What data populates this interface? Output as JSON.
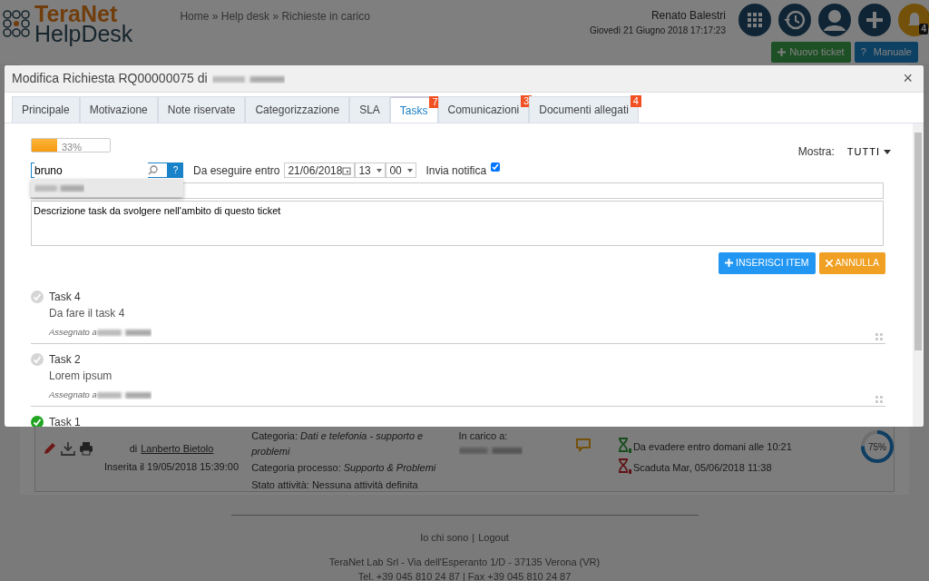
{
  "header": {
    "logo_top": "TeraNet",
    "logo_bottom": "HelpDesk",
    "breadcrumb": "Home » Help desk » Richieste in carico",
    "user_name": "Renato Balestri",
    "datetime": "Giovedì 21 Giugno 2018 17:17:23",
    "notification_count": "4",
    "buttons": [
      {
        "kind": "new",
        "label": "Nuovo ticket"
      },
      {
        "kind": "manual",
        "symbol": "?",
        "label": "Manuale"
      }
    ]
  },
  "ticket": {
    "author_prefix": "di",
    "author": "Lanberto Bietolo",
    "inserted": "Inserita il 19/05/2018 15:39:00",
    "category": "Categoria: *Dati e telefonia - supporto e problemi*",
    "process": "Categoria processo: *Supporto & Problemi*",
    "state": "Stato attività:  Nessuna attività definita",
    "assignee_label": "In carico a:",
    "deadlines": [
      {
        "kind": "due",
        "text": "Da evadere entro domani alle 10:21"
      },
      {
        "kind": "expired",
        "text": "Scaduta Mar, 05/06/2018 11:38"
      }
    ],
    "progress": {
      "level": 0.75,
      "label": "75%"
    }
  },
  "footer": {
    "links": [
      "Io chi sono",
      "Logout"
    ],
    "separator": "|",
    "address": "TeraNet Lab Srl - Via dell'Esperanto 1/D - 37135 Verona (VR)",
    "phone": "Tel. +39 045 810 24 87 | Fax +39 045 810 24 87"
  },
  "modal": {
    "title": "Modifica Richiesta RQ00000075 di",
    "close": "×",
    "tabs": [
      {
        "label": "Principale",
        "selected": false
      },
      {
        "label": "Motivazione",
        "selected": false
      },
      {
        "label": "Note riservate",
        "selected": false
      },
      {
        "label": "Categorizzazione",
        "selected": false
      },
      {
        "label": "SLA",
        "selected": false
      },
      {
        "label": "Tasks",
        "selected": true,
        "badge": "7"
      },
      {
        "label": "Comunicazioni",
        "selected": false,
        "badge": "3"
      },
      {
        "label": "Documenti allegati",
        "selected": false,
        "badge": "4"
      }
    ],
    "progress": {
      "level": 0.33,
      "label": "33%"
    },
    "filter": {
      "label": "Mostra:",
      "value": "TUTTI"
    },
    "search": {
      "value": "bruno",
      "help": "?"
    },
    "due": {
      "label": "Da eseguire entro",
      "date": "21/06/2018",
      "hour": "13",
      "minute": "00"
    },
    "notify": {
      "label": "Invia notifica",
      "checked": true
    },
    "description": {
      "value": "Descrizione task da svolgere nell'ambito di questo ticket"
    },
    "buttons": [
      {
        "kind": "insert",
        "label": "INSERISCI ITEM"
      },
      {
        "kind": "cancel",
        "label": "ANNULLA"
      }
    ],
    "tasks": [
      {
        "title": "Task 4",
        "description": "Da fare il task 4",
        "assigned": "Assegnato a",
        "done": false
      },
      {
        "title": "Task 2",
        "description": "Lorem ipsum",
        "assigned": "Assegnato a",
        "done": false
      },
      {
        "title": "Task 1",
        "done": true
      }
    ]
  }
}
